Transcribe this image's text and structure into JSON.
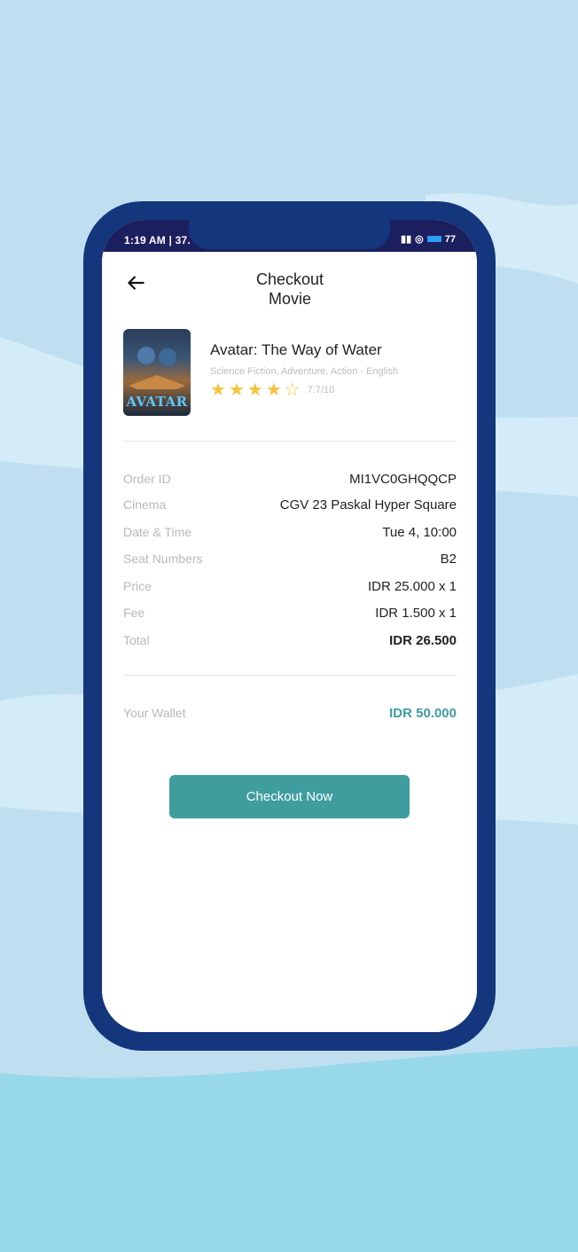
{
  "status_bar": {
    "time": "1:19 AM | 37.",
    "battery": "77"
  },
  "header": {
    "title_line1": "Checkout",
    "title_line2": "Movie"
  },
  "movie": {
    "poster_text": "AVATAR",
    "title": "Avatar: The Way of Water",
    "genre": "Science Fiction, Adventure, Action - English",
    "rating_stars": 4,
    "rating_text": "7.7/10"
  },
  "details": [
    {
      "label": "Order ID",
      "value": "MI1VC0GHQQCP"
    },
    {
      "label": "Cinema",
      "value": "CGV 23 Paskal Hyper Square"
    },
    {
      "label": "Date & Time",
      "value": "Tue 4, 10:00"
    },
    {
      "label": "Seat Numbers",
      "value": "B2"
    },
    {
      "label": "Price",
      "value": "IDR 25.000 x 1"
    },
    {
      "label": "Fee",
      "value": "IDR 1.500 x 1"
    },
    {
      "label": "Total",
      "value": "IDR 26.500"
    }
  ],
  "wallet": {
    "label": "Your Wallet",
    "value": "IDR 50.000"
  },
  "checkout_button": "Checkout Now",
  "colors": {
    "background": "#bfdff1",
    "phone_frame": "#13367d",
    "accent_teal": "#3f9d9e",
    "star": "#f6c33c"
  }
}
